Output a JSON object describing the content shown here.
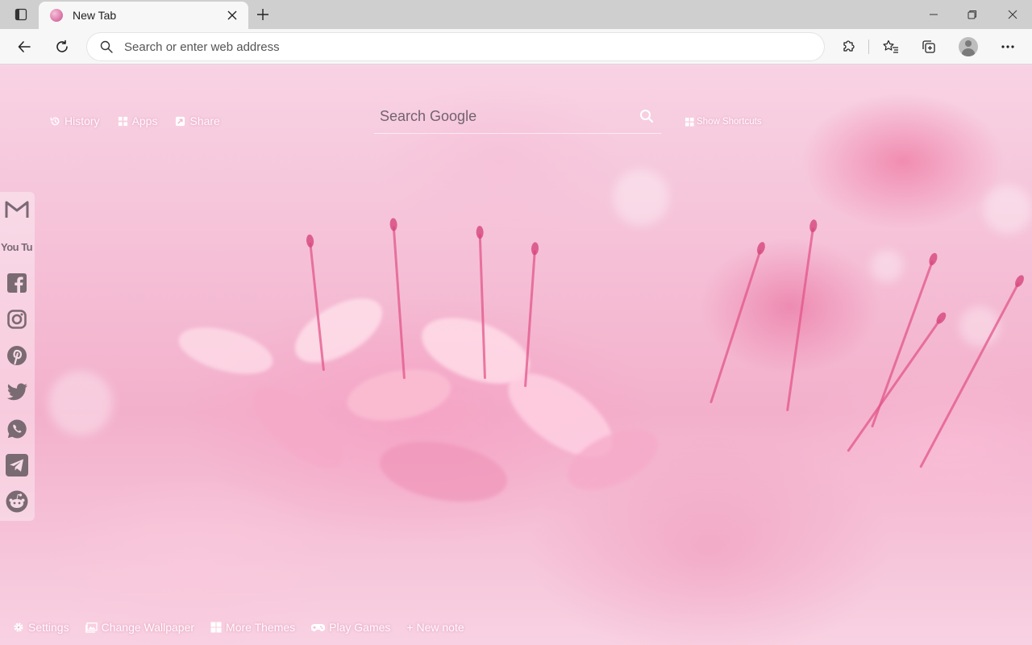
{
  "browser": {
    "tab": {
      "title": "New Tab",
      "favicon": "pink-flower-favicon"
    },
    "address_bar": {
      "placeholder": "Search or enter web address",
      "value": ""
    },
    "icons": {
      "tab_actions": "tab-actions-icon",
      "close_tab": "close-icon",
      "new_tab": "plus-icon",
      "minimize": "minimize-icon",
      "maximize": "restore-icon",
      "close_window": "close-icon",
      "back": "arrow-left-icon",
      "reload": "reload-icon",
      "search": "search-icon",
      "extensions": "puzzle-icon",
      "favorites": "star-list-icon",
      "collections": "collections-icon",
      "profile": "avatar-icon",
      "more": "more-dots-icon"
    }
  },
  "page": {
    "top_links": [
      {
        "label": "History",
        "icon": "history-icon"
      },
      {
        "label": "Apps",
        "icon": "apps-grid-icon"
      },
      {
        "label": "Share",
        "icon": "share-icon"
      }
    ],
    "google_search": {
      "placeholder": "Search Google",
      "value": ""
    },
    "show_shortcuts": "Show Shortcuts",
    "social_links": [
      {
        "name": "Gmail",
        "icon": "gmail-icon"
      },
      {
        "name": "YouTube",
        "icon": "youtube-icon",
        "text": "You Tube"
      },
      {
        "name": "Facebook",
        "icon": "facebook-icon"
      },
      {
        "name": "Instagram",
        "icon": "instagram-icon"
      },
      {
        "name": "Pinterest",
        "icon": "pinterest-icon"
      },
      {
        "name": "Twitter",
        "icon": "twitter-icon"
      },
      {
        "name": "WhatsApp",
        "icon": "whatsapp-icon"
      },
      {
        "name": "Telegram",
        "icon": "telegram-icon"
      },
      {
        "name": "Reddit",
        "icon": "reddit-icon"
      }
    ],
    "bottom_links": [
      {
        "label": "Settings",
        "icon": "gear-icon"
      },
      {
        "label": "Change Wallpaper",
        "icon": "image-icon"
      },
      {
        "label": "More Themes",
        "icon": "grid-icon"
      },
      {
        "label": "Play Games",
        "icon": "gamepad-icon"
      },
      {
        "label": "+ New note",
        "icon": ""
      }
    ]
  },
  "colors": {
    "wallpaper_pink": "#f3b0cb",
    "chrome_bg": "#f7f7f7",
    "titlebar_bg": "#cfcfcf",
    "social_icon": "#7a6a72"
  }
}
